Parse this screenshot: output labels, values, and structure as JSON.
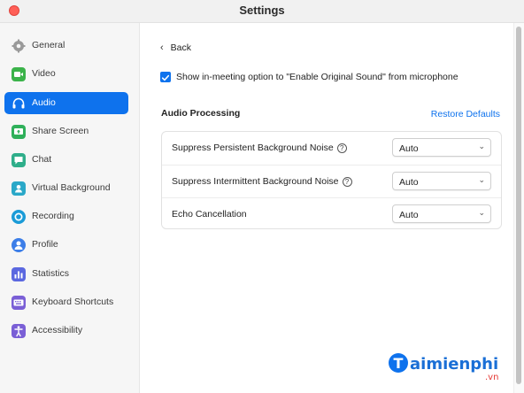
{
  "window": {
    "title": "Settings"
  },
  "sidebar": {
    "items": [
      {
        "label": "General",
        "icon": "gear-icon",
        "color": "#8e8e8e"
      },
      {
        "label": "Video",
        "icon": "video-icon",
        "color": "#3bb34a"
      },
      {
        "label": "Audio",
        "icon": "headphones-icon",
        "color": "#ffffff"
      },
      {
        "label": "Share Screen",
        "icon": "share-screen-icon",
        "color": "#2fb05a"
      },
      {
        "label": "Chat",
        "icon": "chat-icon",
        "color": "#2fae8a"
      },
      {
        "label": "Virtual Background",
        "icon": "person-icon",
        "color": "#2aa8c8"
      },
      {
        "label": "Recording",
        "icon": "record-icon",
        "color": "#1a9bd7"
      },
      {
        "label": "Profile",
        "icon": "profile-icon",
        "color": "#3c7ee8"
      },
      {
        "label": "Statistics",
        "icon": "statistics-icon",
        "color": "#5b68e0"
      },
      {
        "label": "Keyboard Shortcuts",
        "icon": "keyboard-icon",
        "color": "#7a5fd6"
      },
      {
        "label": "Accessibility",
        "icon": "accessibility-icon",
        "color": "#7a5fd6"
      }
    ],
    "active_index": 2,
    "accent": "#0e72ed"
  },
  "main": {
    "back_label": "Back",
    "original_sound": {
      "label": "Show in-meeting option to \"Enable Original Sound\" from microphone",
      "checked": true
    },
    "audio_processing": {
      "title": "Audio Processing",
      "restore_label": "Restore Defaults",
      "rows": [
        {
          "label": "Suppress Persistent Background Noise",
          "help": true,
          "value": "Auto"
        },
        {
          "label": "Suppress Intermittent Background Noise",
          "help": true,
          "value": "Auto"
        },
        {
          "label": "Echo Cancellation",
          "help": false,
          "value": "Auto"
        }
      ]
    }
  },
  "watermark": {
    "text_main": "aimienphi",
    "text_suffix": ".vn",
    "letter": "T"
  }
}
